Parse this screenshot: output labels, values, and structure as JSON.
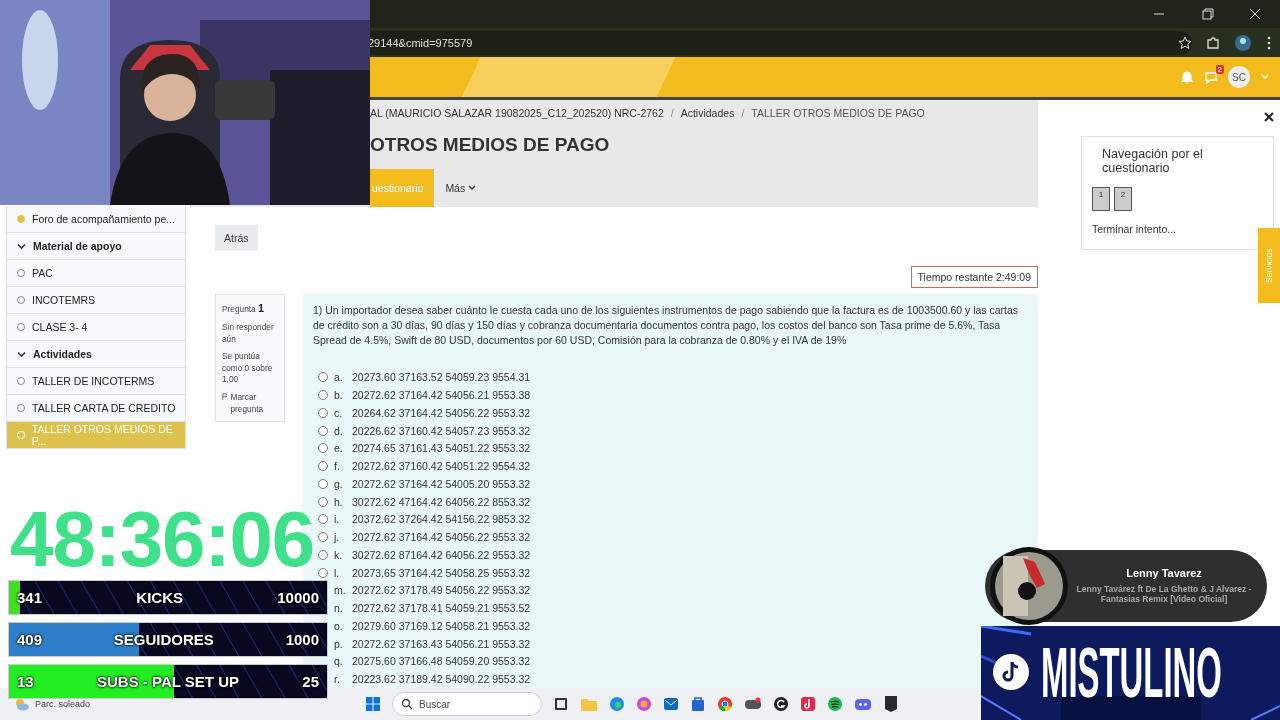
{
  "browser": {
    "url": "29144&cmid=975579"
  },
  "navbar": {
    "message_badge": "2",
    "avatar": "SC"
  },
  "breadcrumb": [
    {
      "kind": "link",
      "label": "AL (MAURICIO SALAZAR 19082025_C12_202520) NRC-2762"
    },
    {
      "kind": "separator",
      "label": "/"
    },
    {
      "kind": "link",
      "label": "Actividades"
    },
    {
      "kind": "separator",
      "label": "/"
    },
    {
      "kind": "current",
      "label": "TALLER OTROS MEDIOS DE PAGO"
    }
  ],
  "page_title": "OTROS MEDIOS DE PAGO",
  "secondary_nav": [
    {
      "label": "uestionario",
      "selected": true
    },
    {
      "label": "Más",
      "selected": false
    }
  ],
  "course_index": [
    {
      "kind": "item",
      "label": "Foro de acompañamiento pe...",
      "completed": true,
      "selected": false
    },
    {
      "kind": "section",
      "label": "Material de apoyo",
      "expanded": true
    },
    {
      "kind": "item",
      "label": "PAC",
      "completed": false,
      "selected": false
    },
    {
      "kind": "item",
      "label": "INCOTEMRS",
      "completed": false,
      "selected": false
    },
    {
      "kind": "item",
      "label": "CLASE 3- 4",
      "completed": false,
      "selected": false
    },
    {
      "kind": "section",
      "label": "Actividades",
      "expanded": true
    },
    {
      "kind": "item",
      "label": "TALLER DE INCOTERMS",
      "completed": false,
      "selected": false
    },
    {
      "kind": "item",
      "label": "TALLER CARTA DE CREDITO",
      "completed": false,
      "selected": false
    },
    {
      "kind": "item",
      "label": "TALLER OTROS MEDIOS DE P...",
      "completed": false,
      "selected": true
    }
  ],
  "back_button": "Atrás",
  "time_left": "Tiempo restante 2:49:09",
  "question_info": {
    "label": "Pregunta",
    "number": "1",
    "status": "Sin responder aún",
    "grade": "Se puntúa como 0 sobre 1,00",
    "flag": "Marcar pregunta"
  },
  "question": {
    "text": "1) Un importador desea saber cuánto le cuesta cada uno de los siguientes instrumentos de pago sabiendo que la factura es de 1003500.60 y las cartas de crédito son a 30 días, 90 días y 150 días y cobranza documentaria documentos contra pago, los costos del banco son Tasa prime de 5.6%, Tasa Spread de 4.5%, Swift de 80 USD, documentos por 60 USD, Comisión para la cobranza de 0.80% y el IVA de 19%",
    "options": [
      {
        "letter": "a.",
        "text": "20273.60 37163.52 54059.23 9554.31",
        "selected": false
      },
      {
        "letter": "b.",
        "text": "20272.62 37164.42 54056.21 9553.38",
        "selected": false
      },
      {
        "letter": "c.",
        "text": "20264.62 37164.42 54056.22 9553.32",
        "selected": false
      },
      {
        "letter": "d.",
        "text": "20226.62 37160.42 54057.23 9553.32",
        "selected": false
      },
      {
        "letter": "e.",
        "text": "20274.65 37161.43 54051.22 9553.32",
        "selected": false
      },
      {
        "letter": "f.",
        "text": "20272.62 37160.42 54051.22 9554.32",
        "selected": false
      },
      {
        "letter": "g.",
        "text": "20272.62 37164.42 54005.20 9553.32",
        "selected": false
      },
      {
        "letter": "h.",
        "text": "30272.62 47164.42 64056.22 8553.32",
        "selected": false
      },
      {
        "letter": "i.",
        "text": "20372.62 37264.42 54156.22 9853.32",
        "selected": false
      },
      {
        "letter": "j.",
        "text": "20272.62 37164.42 54056.22 9553.32",
        "selected": false
      },
      {
        "letter": "k.",
        "text": "30272.62 87164.42 64056.22 9553.32",
        "selected": false
      },
      {
        "letter": "l.",
        "text": "20273.65 37164.42 54058.25 9553.32",
        "selected": false
      },
      {
        "letter": "m.",
        "text": "20272.62 37178.49 54056.22 9553.32"
      },
      {
        "letter": "n.",
        "text": "20272.62 37178.41 54059.21 9553.52"
      },
      {
        "letter": "o.",
        "text": "20279.60 37169.12 54058.21 9553.32"
      },
      {
        "letter": "p.",
        "text": "20272.62 37163.43 54056.21 9553.32"
      },
      {
        "letter": "q.",
        "text": "20275.60 37166.48 54059.20 9553.32"
      },
      {
        "letter": "r.",
        "text": "20223.62 37189.42 54090.22 9553.32"
      }
    ]
  },
  "quiz_nav": {
    "title": "Navegación por el cuestionario",
    "pages": [
      {
        "label": "1"
      },
      {
        "label": "2"
      }
    ],
    "finish": "Terminar intento..."
  },
  "services_tab": "Servicios",
  "taskbar": {
    "weather": "Parc. soleado",
    "search_placeholder": "Buscar"
  },
  "stream_overlay": {
    "timer": "48:36:06",
    "goals": [
      {
        "value": "341",
        "label": "KICKS",
        "goal": "10000",
        "level": 0.034,
        "color": "#3fe01f"
      },
      {
        "value": "409",
        "label": "SEGUIDORES",
        "goal": "1000",
        "level": 0.409,
        "color": "#2d7fc9"
      },
      {
        "value": "13",
        "label": "SUBS - PAL SET UP",
        "goal": "25",
        "level": 0.52,
        "color": "#22ee22"
      }
    ],
    "now_playing": {
      "artist": "Lenny Tavarez",
      "title": "Lenny Tavárez ft De La Ghetto & J Alvarez - Fantasias Remix [Video Oficial]"
    },
    "banner": "MISTULINO"
  }
}
